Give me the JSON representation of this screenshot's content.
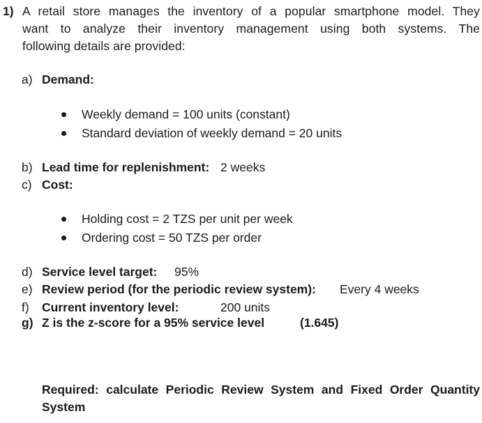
{
  "question": {
    "number": "1)",
    "intro_lines": [
      "A retail store manages the inventory of a popular smartphone model. They",
      "want to analyze their inventory management using both systems. The",
      "following details are provided:"
    ],
    "items": {
      "a": {
        "letter": "a)",
        "label": "Demand:",
        "bullets": [
          "Weekly demand = 100 units (constant)",
          "Standard deviation of weekly demand = 20 units"
        ]
      },
      "b": {
        "letter": "b)",
        "label": "Lead time for replenishment:",
        "value": "2 weeks"
      },
      "c": {
        "letter": "c)",
        "label": "Cost:",
        "bullets": [
          "Holding cost = 2 TZS per unit per week",
          "Ordering cost = 50 TZS per order"
        ]
      },
      "d": {
        "letter": "d)",
        "label": "Service level target:",
        "value": "95%"
      },
      "e": {
        "letter": "e)",
        "label": "Review period (for the periodic review system):",
        "value": "Every 4 weeks"
      },
      "f": {
        "letter": "f)",
        "label": "Current inventory level:",
        "value": "200 units"
      },
      "g": {
        "letter": "g)",
        "label": "Z is the z-score for a 95% service level",
        "value": "(1.645)"
      }
    },
    "required_lines": [
      "Required: calculate Periodic Review System and Fixed Order Quantity",
      "System"
    ]
  }
}
